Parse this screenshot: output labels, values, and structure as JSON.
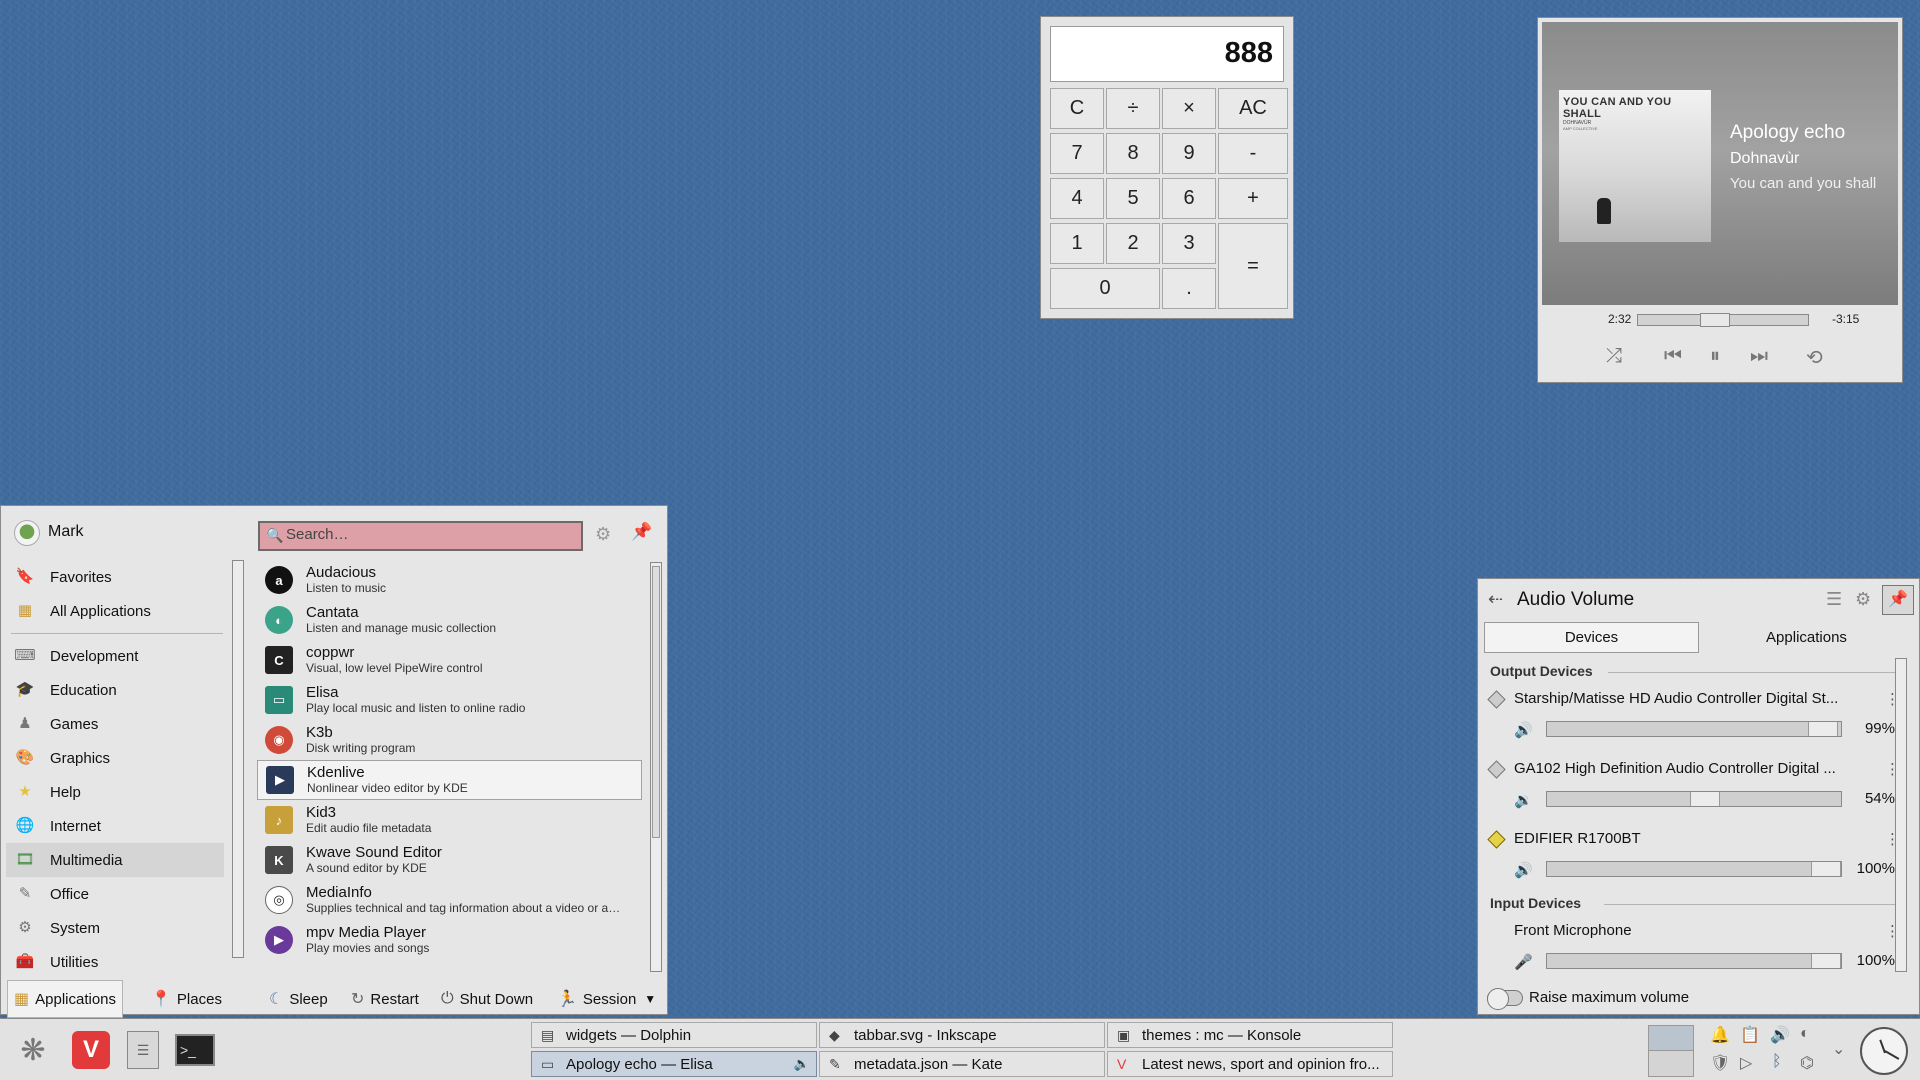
{
  "calculator": {
    "display": "888",
    "keys": [
      "C",
      "÷",
      "×",
      "AC",
      "7",
      "8",
      "9",
      "-",
      "4",
      "5",
      "6",
      "+",
      "1",
      "2",
      "3",
      "=",
      "0",
      "."
    ]
  },
  "media_player": {
    "track_title": "Apology echo",
    "artist": "Dohnavùr",
    "album": "You can and you shall",
    "cover_title": "YOU CAN AND YOU SHALL",
    "cover_artist": "DOHNAVÙR",
    "cover_label": "AMP COLLECTIVE",
    "time_elapsed": "2:32",
    "time_remaining": "-3:15",
    "progress_fraction": 0.44
  },
  "launcher": {
    "user_name": "Mark",
    "search_placeholder": "Search…",
    "categories": [
      {
        "label": "Favorites",
        "icon": "bookmark-icon"
      },
      {
        "label": "All Applications",
        "icon": "grid-icon"
      },
      {
        "label": "Development",
        "icon": "code-icon"
      },
      {
        "label": "Education",
        "icon": "education-icon"
      },
      {
        "label": "Games",
        "icon": "games-icon"
      },
      {
        "label": "Graphics",
        "icon": "graphics-icon"
      },
      {
        "label": "Help",
        "icon": "help-icon"
      },
      {
        "label": "Internet",
        "icon": "globe-icon"
      },
      {
        "label": "Multimedia",
        "icon": "multimedia-icon"
      },
      {
        "label": "Office",
        "icon": "office-icon"
      },
      {
        "label": "System",
        "icon": "system-icon"
      },
      {
        "label": "Utilities",
        "icon": "utilities-icon"
      }
    ],
    "apps": [
      {
        "name": "Audacious",
        "desc": "Listen to music"
      },
      {
        "name": "Cantata",
        "desc": "Listen and manage music collection"
      },
      {
        "name": "coppwr",
        "desc": "Visual, low level PipeWire control"
      },
      {
        "name": "Elisa",
        "desc": "Play local music and listen to online radio"
      },
      {
        "name": "K3b",
        "desc": "Disk writing program"
      },
      {
        "name": "Kdenlive",
        "desc": "Nonlinear video editor by KDE"
      },
      {
        "name": "Kid3",
        "desc": "Edit audio file metadata"
      },
      {
        "name": "Kwave Sound Editor",
        "desc": "A sound editor by KDE"
      },
      {
        "name": "MediaInfo",
        "desc": "Supplies technical and tag information about a video or au…"
      },
      {
        "name": "mpv Media Player",
        "desc": "Play movies and songs"
      }
    ],
    "footer": {
      "applications": "Applications",
      "places": "Places",
      "sleep": "Sleep",
      "restart": "Restart",
      "shutdown": "Shut Down",
      "session": "Session"
    }
  },
  "audio_volume": {
    "title": "Audio Volume",
    "tabs": [
      "Devices",
      "Applications"
    ],
    "output_title": "Output Devices",
    "input_title": "Input Devices",
    "outputs": [
      {
        "name": "Starship/Matisse HD Audio Controller Digital St...",
        "percent": "99%",
        "level": 0.99
      },
      {
        "name": "GA102 High Definition Audio Controller Digital ...",
        "percent": "54%",
        "level": 0.54
      },
      {
        "name": "EDIFIER R1700BT",
        "percent": "100%",
        "level": 1.0
      }
    ],
    "inputs": [
      {
        "name": "Front Microphone",
        "percent": "100%",
        "level": 1.0
      }
    ],
    "raise_max_label": "Raise maximum volume"
  },
  "taskbar": {
    "tasks_row1": [
      {
        "label": "widgets — Dolphin",
        "icon": "folder-icon"
      },
      {
        "label": "tabbar.svg - Inkscape",
        "icon": "inkscape-icon"
      },
      {
        "label": "themes : mc — Konsole",
        "icon": "terminal-icon"
      }
    ],
    "tasks_row2": [
      {
        "label": "Apology echo — Elisa",
        "icon": "elisa-icon"
      },
      {
        "label": "metadata.json — Kate",
        "icon": "kate-icon"
      },
      {
        "label": "Latest news, sport and opinion fro...",
        "icon": "vivaldi-icon"
      }
    ]
  }
}
